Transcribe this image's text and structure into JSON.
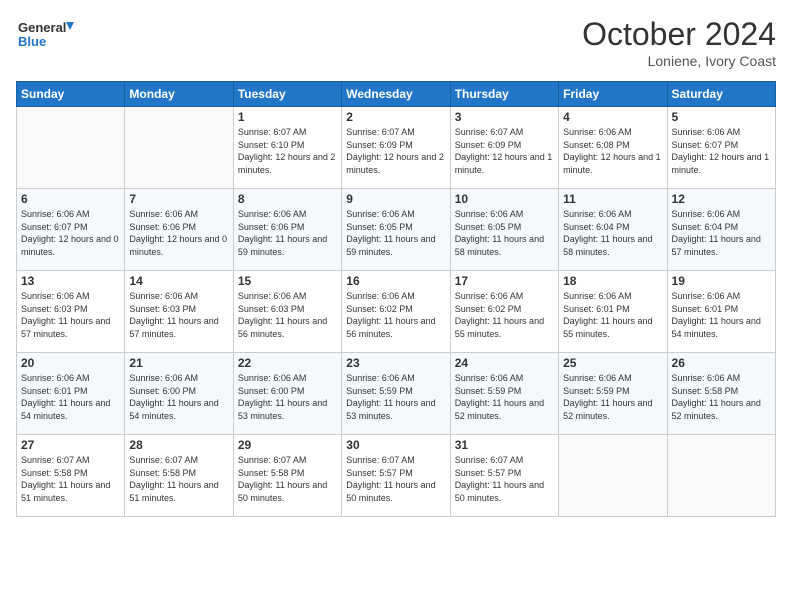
{
  "logo": {
    "line1": "General",
    "line2": "Blue"
  },
  "title": "October 2024",
  "location": "Loniene, Ivory Coast",
  "days_of_week": [
    "Sunday",
    "Monday",
    "Tuesday",
    "Wednesday",
    "Thursday",
    "Friday",
    "Saturday"
  ],
  "weeks": [
    [
      {
        "day": "",
        "info": ""
      },
      {
        "day": "",
        "info": ""
      },
      {
        "day": "1",
        "info": "Sunrise: 6:07 AM\nSunset: 6:10 PM\nDaylight: 12 hours\nand 2 minutes."
      },
      {
        "day": "2",
        "info": "Sunrise: 6:07 AM\nSunset: 6:09 PM\nDaylight: 12 hours\nand 2 minutes."
      },
      {
        "day": "3",
        "info": "Sunrise: 6:07 AM\nSunset: 6:09 PM\nDaylight: 12 hours\nand 1 minute."
      },
      {
        "day": "4",
        "info": "Sunrise: 6:06 AM\nSunset: 6:08 PM\nDaylight: 12 hours\nand 1 minute."
      },
      {
        "day": "5",
        "info": "Sunrise: 6:06 AM\nSunset: 6:07 PM\nDaylight: 12 hours\nand 1 minute."
      }
    ],
    [
      {
        "day": "6",
        "info": "Sunrise: 6:06 AM\nSunset: 6:07 PM\nDaylight: 12 hours\nand 0 minutes."
      },
      {
        "day": "7",
        "info": "Sunrise: 6:06 AM\nSunset: 6:06 PM\nDaylight: 12 hours\nand 0 minutes."
      },
      {
        "day": "8",
        "info": "Sunrise: 6:06 AM\nSunset: 6:06 PM\nDaylight: 11 hours\nand 59 minutes."
      },
      {
        "day": "9",
        "info": "Sunrise: 6:06 AM\nSunset: 6:05 PM\nDaylight: 11 hours\nand 59 minutes."
      },
      {
        "day": "10",
        "info": "Sunrise: 6:06 AM\nSunset: 6:05 PM\nDaylight: 11 hours\nand 58 minutes."
      },
      {
        "day": "11",
        "info": "Sunrise: 6:06 AM\nSunset: 6:04 PM\nDaylight: 11 hours\nand 58 minutes."
      },
      {
        "day": "12",
        "info": "Sunrise: 6:06 AM\nSunset: 6:04 PM\nDaylight: 11 hours\nand 57 minutes."
      }
    ],
    [
      {
        "day": "13",
        "info": "Sunrise: 6:06 AM\nSunset: 6:03 PM\nDaylight: 11 hours\nand 57 minutes."
      },
      {
        "day": "14",
        "info": "Sunrise: 6:06 AM\nSunset: 6:03 PM\nDaylight: 11 hours\nand 57 minutes."
      },
      {
        "day": "15",
        "info": "Sunrise: 6:06 AM\nSunset: 6:03 PM\nDaylight: 11 hours\nand 56 minutes."
      },
      {
        "day": "16",
        "info": "Sunrise: 6:06 AM\nSunset: 6:02 PM\nDaylight: 11 hours\nand 56 minutes."
      },
      {
        "day": "17",
        "info": "Sunrise: 6:06 AM\nSunset: 6:02 PM\nDaylight: 11 hours\nand 55 minutes."
      },
      {
        "day": "18",
        "info": "Sunrise: 6:06 AM\nSunset: 6:01 PM\nDaylight: 11 hours\nand 55 minutes."
      },
      {
        "day": "19",
        "info": "Sunrise: 6:06 AM\nSunset: 6:01 PM\nDaylight: 11 hours\nand 54 minutes."
      }
    ],
    [
      {
        "day": "20",
        "info": "Sunrise: 6:06 AM\nSunset: 6:01 PM\nDaylight: 11 hours\nand 54 minutes."
      },
      {
        "day": "21",
        "info": "Sunrise: 6:06 AM\nSunset: 6:00 PM\nDaylight: 11 hours\nand 54 minutes."
      },
      {
        "day": "22",
        "info": "Sunrise: 6:06 AM\nSunset: 6:00 PM\nDaylight: 11 hours\nand 53 minutes."
      },
      {
        "day": "23",
        "info": "Sunrise: 6:06 AM\nSunset: 5:59 PM\nDaylight: 11 hours\nand 53 minutes."
      },
      {
        "day": "24",
        "info": "Sunrise: 6:06 AM\nSunset: 5:59 PM\nDaylight: 11 hours\nand 52 minutes."
      },
      {
        "day": "25",
        "info": "Sunrise: 6:06 AM\nSunset: 5:59 PM\nDaylight: 11 hours\nand 52 minutes."
      },
      {
        "day": "26",
        "info": "Sunrise: 6:06 AM\nSunset: 5:58 PM\nDaylight: 11 hours\nand 52 minutes."
      }
    ],
    [
      {
        "day": "27",
        "info": "Sunrise: 6:07 AM\nSunset: 5:58 PM\nDaylight: 11 hours\nand 51 minutes."
      },
      {
        "day": "28",
        "info": "Sunrise: 6:07 AM\nSunset: 5:58 PM\nDaylight: 11 hours\nand 51 minutes."
      },
      {
        "day": "29",
        "info": "Sunrise: 6:07 AM\nSunset: 5:58 PM\nDaylight: 11 hours\nand 50 minutes."
      },
      {
        "day": "30",
        "info": "Sunrise: 6:07 AM\nSunset: 5:57 PM\nDaylight: 11 hours\nand 50 minutes."
      },
      {
        "day": "31",
        "info": "Sunrise: 6:07 AM\nSunset: 5:57 PM\nDaylight: 11 hours\nand 50 minutes."
      },
      {
        "day": "",
        "info": ""
      },
      {
        "day": "",
        "info": ""
      }
    ]
  ]
}
